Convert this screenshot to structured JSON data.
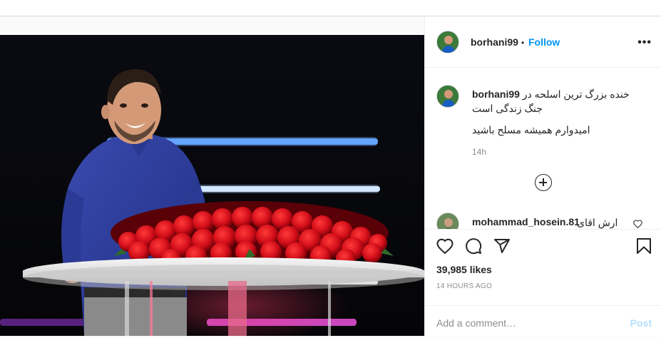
{
  "post": {
    "username": "borhani99",
    "separator": "•",
    "follow_label": "Follow",
    "more_label": "•••"
  },
  "caption": {
    "username": "borhani99",
    "text": "خنده بزرگ ترین اسلحه در جنگ زندگی است",
    "text2": "امیدوارم همیشه مسلح باشید",
    "time": "14h"
  },
  "comment": {
    "username": "mohammad_hosein.81",
    "text": "ارش اقای"
  },
  "stats": {
    "likes": "39,985 likes",
    "time_ago": "14 HOURS AGO"
  },
  "add_comment": {
    "placeholder": "Add a comment…",
    "post_label": "Post"
  },
  "icons": {
    "like": "heart-icon",
    "comment": "comment-bubble-icon",
    "share": "paper-plane-icon",
    "save": "bookmark-icon",
    "more": "more-options-icon",
    "load_more": "plus-circle-icon"
  },
  "colors": {
    "follow": "#0095f6",
    "post_disabled": "#b2dffc",
    "secondary_text": "#8e8e8e"
  }
}
